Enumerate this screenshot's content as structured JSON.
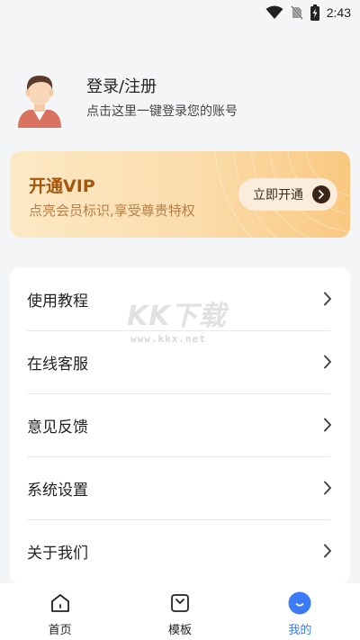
{
  "status_bar": {
    "time": "2:43",
    "icons": [
      "wifi-icon",
      "no-sim-icon",
      "battery-charging-icon"
    ]
  },
  "profile": {
    "title": "登录/注册",
    "subtitle": "点击这里一键登录您的账号",
    "avatar_icon": "user-avatar-icon"
  },
  "vip": {
    "title": "开通VIP",
    "subtitle": "点亮会员标识,享受尊贵特权",
    "button_label": "立即开通",
    "colors": {
      "title": "#a4560f",
      "subtitle": "#b77f48",
      "card_start": "#fde9c6",
      "card_end": "#f9c880"
    }
  },
  "menu": {
    "items": [
      {
        "label": "使用教程",
        "icon": "chevron-right-icon"
      },
      {
        "label": "在线客服",
        "icon": "chevron-right-icon"
      },
      {
        "label": "意见反馈",
        "icon": "chevron-right-icon"
      },
      {
        "label": "系统设置",
        "icon": "chevron-right-icon"
      },
      {
        "label": "关于我们",
        "icon": "chevron-right-icon"
      }
    ]
  },
  "watermark": {
    "main": "KK下载",
    "url": "www.kkx.net"
  },
  "nav": {
    "items": [
      {
        "label": "首页",
        "icon": "home-icon",
        "active": false
      },
      {
        "label": "模板",
        "icon": "template-icon",
        "active": false
      },
      {
        "label": "我的",
        "icon": "profile-smile-icon",
        "active": true
      }
    ],
    "active_color": "#3b7cf6"
  }
}
